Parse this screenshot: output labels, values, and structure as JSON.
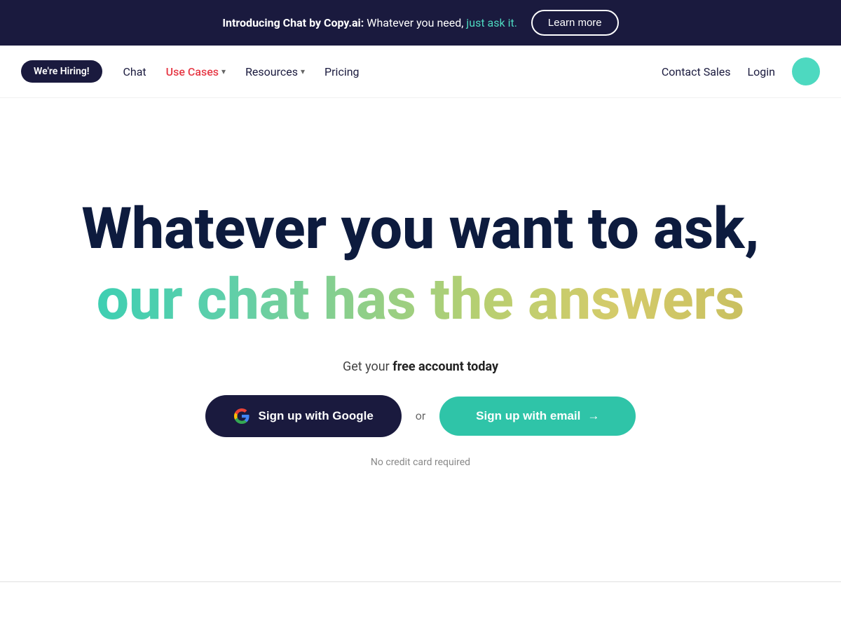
{
  "banner": {
    "intro": "Introducing Chat by Copy.ai:",
    "main_text": " Whatever you need, ",
    "highlight": "just ask it.",
    "learn_more_label": "Learn more"
  },
  "navbar": {
    "hiring_label": "We're Hiring!",
    "links": [
      {
        "label": "Chat",
        "has_dropdown": false,
        "color": "normal"
      },
      {
        "label": "Use Cases",
        "has_dropdown": true,
        "color": "red"
      },
      {
        "label": "Resources",
        "has_dropdown": true,
        "color": "normal"
      },
      {
        "label": "Pricing",
        "has_dropdown": false,
        "color": "normal"
      }
    ],
    "contact_sales_label": "Contact Sales",
    "login_label": "Login"
  },
  "hero": {
    "title_line1": "Whatever you want to ask,",
    "title_line2": "our chat has the answers",
    "cta_text_prefix": "Get your ",
    "cta_text_bold": "free account today",
    "google_button_label": "Sign up with Google",
    "or_text": "or",
    "email_button_label": "Sign up with email",
    "no_cc_label": "No credit card required"
  },
  "colors": {
    "brand_dark": "#1a1a3e",
    "brand_teal": "#2fc4a8",
    "banner_bg": "#1a1a3e"
  }
}
